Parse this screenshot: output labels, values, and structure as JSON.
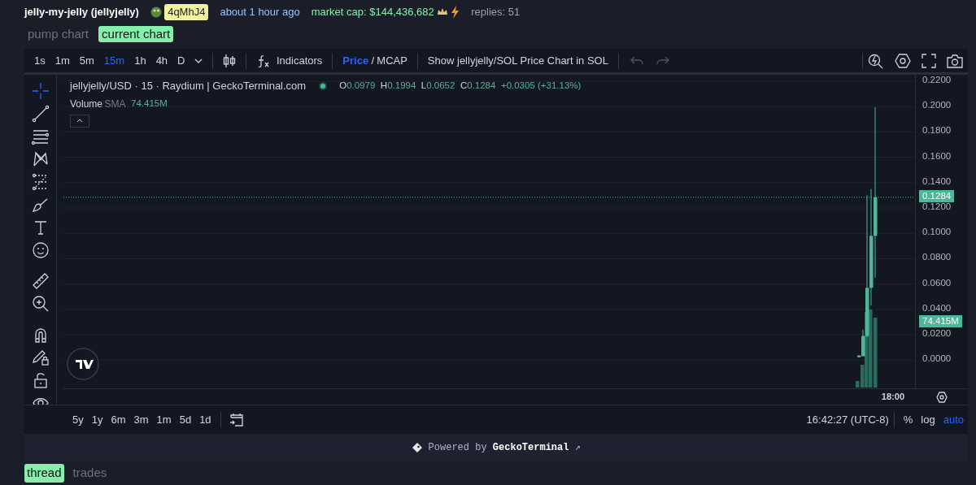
{
  "token": {
    "name": "jelly-my-jelly (jellyjelly)",
    "ticker": "4qMhJ4",
    "age": "about 1 hour ago",
    "market_cap": "market cap: $144,436,682",
    "replies": "replies: 51"
  },
  "chart_tabs": [
    {
      "label": "pump chart",
      "selected": false
    },
    {
      "label": "current chart",
      "selected": true
    }
  ],
  "toolbar": {
    "intervals": [
      {
        "label": "1s",
        "selected": false
      },
      {
        "label": "1m",
        "selected": false
      },
      {
        "label": "5m",
        "selected": false
      },
      {
        "label": "15m",
        "selected": true
      },
      {
        "label": "1h",
        "selected": false
      },
      {
        "label": "4h",
        "selected": false
      },
      {
        "label": "D",
        "selected": false
      }
    ],
    "indicators": "Indicators",
    "price_modes": [
      {
        "label": "Price",
        "selected": true
      },
      {
        "label": "MCAP",
        "selected": false
      }
    ],
    "mode_separator": "/",
    "sol_toggle": "Show jellyjelly/SOL Price Chart in SOL"
  },
  "tools": [
    {
      "kind": "crosshair",
      "selected": true
    },
    {
      "kind": "trendline",
      "selected": false
    },
    {
      "kind": "lines",
      "selected": false
    },
    {
      "kind": "pattern",
      "selected": false
    },
    {
      "kind": "forecast",
      "selected": false
    },
    {
      "kind": "brush",
      "selected": false
    },
    {
      "kind": "text",
      "selected": false
    },
    {
      "kind": "emoji",
      "selected": false
    },
    {
      "kind": "divider"
    },
    {
      "kind": "ruler",
      "selected": false
    },
    {
      "kind": "zoom",
      "selected": false
    },
    {
      "kind": "divider"
    },
    {
      "kind": "magnet",
      "selected": false
    },
    {
      "kind": "pencil-lock",
      "selected": false
    },
    {
      "kind": "lock",
      "selected": false
    },
    {
      "kind": "eye",
      "selected": false
    }
  ],
  "legend": {
    "symbol": "jellyjelly/USD · 15 · Raydium | GeckoTerminal.com",
    "ohlc": [
      {
        "label": "O",
        "value": "0.0979"
      },
      {
        "label": "H",
        "value": "0.1994"
      },
      {
        "label": "L",
        "value": "0.0652"
      },
      {
        "label": "C",
        "value": "0.1284"
      }
    ],
    "change": "+0.0305 (+31.13%)",
    "volume_label": "Volume",
    "volume_ma": "SMA",
    "volume_value": "74.415M"
  },
  "price_axis": [
    "0.2200",
    "0.2000",
    "0.1800",
    "0.1600",
    "0.1400",
    "0.1200",
    "0.1000",
    "0.0800",
    "0.0600",
    "0.0400",
    "0.0200",
    "0.0000"
  ],
  "last_price": "0.1284",
  "volume_tag": "74.415M",
  "time_label": "18:00",
  "ranges": [
    "5y",
    "1y",
    "6m",
    "3m",
    "1m",
    "5d",
    "1d"
  ],
  "clock": "16:42:27 (UTC-8)",
  "scale_options": [
    {
      "label": "%",
      "on": false
    },
    {
      "label": "log",
      "on": false
    },
    {
      "label": "auto",
      "on": true
    }
  ],
  "footer": {
    "prefix": "Powered by",
    "brand": "GeckoTerminal",
    "arrow": "↗"
  },
  "bottom_tabs": [
    {
      "label": "thread",
      "selected": true
    },
    {
      "label": "trades",
      "selected": false
    }
  ]
}
